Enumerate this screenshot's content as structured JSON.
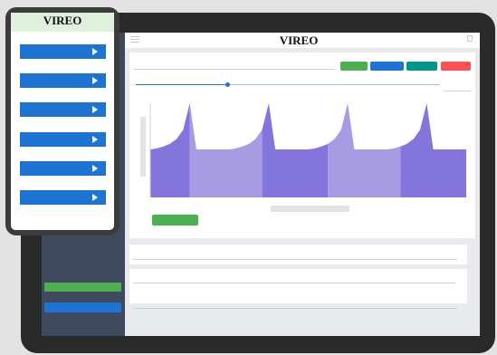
{
  "tablet": {
    "brand": "VIREO"
  },
  "phone": {
    "brand": "VIREO",
    "menu_items": [
      {
        "name": "phone-menu-item-1"
      },
      {
        "name": "phone-menu-item-2"
      },
      {
        "name": "phone-menu-item-3"
      },
      {
        "name": "phone-menu-item-4"
      },
      {
        "name": "phone-menu-item-5"
      },
      {
        "name": "phone-menu-item-6"
      }
    ]
  },
  "colors": {
    "accent_blue": "#1e74d3",
    "green": "#4caf50",
    "teal": "#009688",
    "red": "#ff5252",
    "sidebar": "#3f4a5f",
    "series_dark": "#8475dd",
    "series_light": "#a79be3"
  },
  "icons": {
    "menu": "hamburger-icon",
    "export": "export-icon",
    "arrow": "play-arrow-icon"
  },
  "slider": {
    "value_fraction": 0.3
  },
  "chart_data": {
    "type": "area",
    "title": "",
    "xlabel": "",
    "ylabel": "",
    "x": [
      0,
      1,
      2,
      3,
      4,
      5,
      6,
      7,
      8,
      9,
      10,
      11,
      12,
      13,
      14,
      15,
      16,
      17,
      18,
      19,
      20,
      21,
      22,
      23,
      24,
      25,
      26,
      27,
      28,
      29,
      30,
      31,
      32,
      33,
      34,
      35,
      36,
      37,
      38,
      39,
      40,
      41,
      42,
      43,
      44,
      45,
      46,
      47,
      48
    ],
    "ylim": [
      0,
      1
    ],
    "xlim": [
      0,
      48
    ],
    "segments": [
      {
        "x_start": 0,
        "x_end": 6,
        "shade": "dark"
      },
      {
        "x_start": 6,
        "x_end": 17,
        "shade": "light"
      },
      {
        "x_start": 17,
        "x_end": 27,
        "shade": "dark"
      },
      {
        "x_start": 27,
        "x_end": 38,
        "shade": "light"
      },
      {
        "x_start": 38,
        "x_end": 48,
        "shade": "dark"
      }
    ],
    "series": [
      {
        "values": [
          0.51,
          0.52,
          0.54,
          0.57,
          0.62,
          0.72,
          1.0,
          0.51,
          0.51,
          0.51,
          0.51,
          0.51,
          0.51,
          0.52,
          0.54,
          0.57,
          0.62,
          0.72,
          1.0,
          0.51,
          0.51,
          0.51,
          0.51,
          0.51,
          0.51,
          0.52,
          0.54,
          0.57,
          0.62,
          0.72,
          1.0,
          0.51,
          0.51,
          0.51,
          0.51,
          0.51,
          0.51,
          0.52,
          0.54,
          0.57,
          0.62,
          0.72,
          1.0,
          0.51,
          0.51,
          0.51,
          0.51,
          0.51,
          0.51
        ]
      }
    ]
  }
}
